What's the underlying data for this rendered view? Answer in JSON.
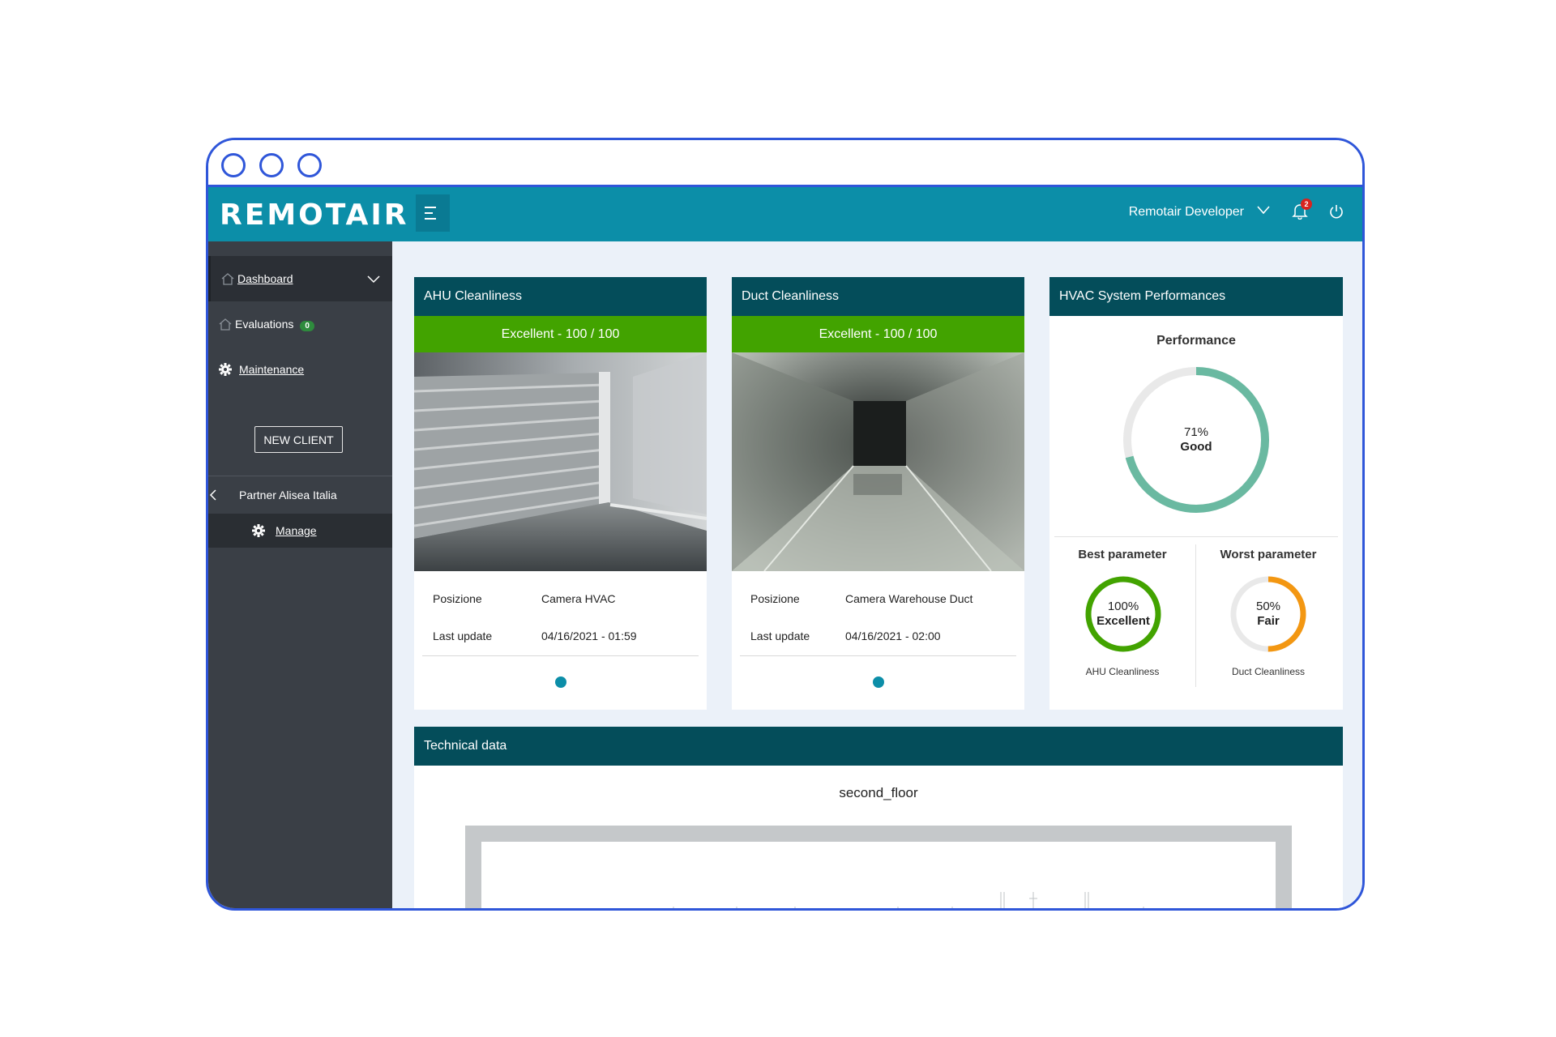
{
  "app": {
    "logo": "REMOTAIR"
  },
  "header": {
    "user": "Remotair Developer",
    "notifications": "2"
  },
  "sidebar": {
    "dashboard": "Dashboard",
    "evaluations": "Evaluations",
    "evaluations_count": "0",
    "maintenance": "Maintenance",
    "new_client": "NEW CLIENT",
    "partner": "Partner Alisea Italia",
    "manage": "Manage"
  },
  "ahu_card": {
    "title": "AHU Cleanliness",
    "status": "Excellent - 100 / 100",
    "position_label": "Posizione",
    "position_value": "Camera HVAC",
    "update_label": "Last update",
    "update_value": "04/16/2021 - 01:59"
  },
  "duct_card": {
    "title": "Duct Cleanliness",
    "status": "Excellent - 100 / 100",
    "position_label": "Posizione",
    "position_value": "Camera Warehouse Duct",
    "update_label": "Last update",
    "update_value": "04/16/2021 - 02:00"
  },
  "hvac_card": {
    "title": "HVAC System Performances",
    "performance_title": "Performance",
    "performance_value": 71,
    "performance_percent": "71%",
    "performance_label": "Good",
    "best_title": "Best parameter",
    "best_value": 100,
    "best_percent": "100%",
    "best_label": "Excellent",
    "best_name": "AHU Cleanliness",
    "worst_title": "Worst parameter",
    "worst_value": 50,
    "worst_percent": "50%",
    "worst_label": "Fair",
    "worst_name": "Duct Cleanliness"
  },
  "technical": {
    "title": "Technical data",
    "floor": "second_floor"
  },
  "colors": {
    "topbar": "#0c8ea8",
    "sidebar": "#3a3f46",
    "card_header": "#044d5a",
    "excellent_green": "#42a300",
    "performance_teal": "#6ab9a1",
    "fair_orange": "#f39712"
  }
}
